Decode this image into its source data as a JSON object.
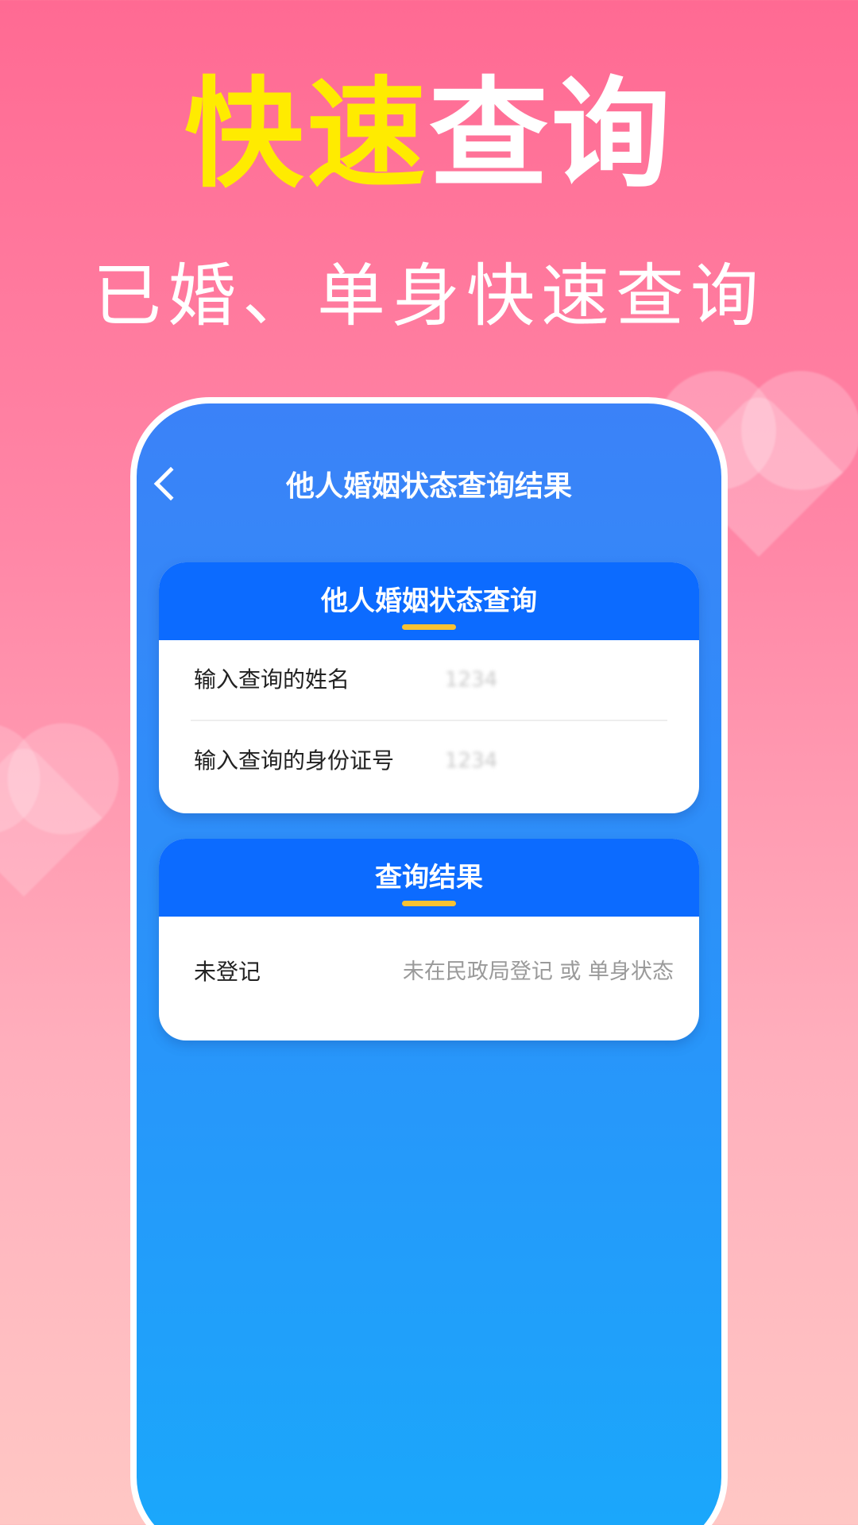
{
  "hero": {
    "title_part1": "快速",
    "title_part2": "查询",
    "subtitle": "已婚、单身快速查询"
  },
  "colors": {
    "accent_yellow": "#ffeb00",
    "card_header_blue": "#0c6bff",
    "underline": "#f8c232"
  },
  "app": {
    "nav": {
      "title": "他人婚姻状态查询结果",
      "back_icon": "chevron-left-icon"
    },
    "query_card": {
      "title": "他人婚姻状态查询",
      "name_label": "输入查询的姓名",
      "name_value": "1234",
      "id_label": "输入查询的身份证号",
      "id_value": "1234"
    },
    "result_card": {
      "title": "查询结果",
      "status_label": "未登记",
      "status_value": "未在民政局登记 或 单身状态"
    }
  }
}
